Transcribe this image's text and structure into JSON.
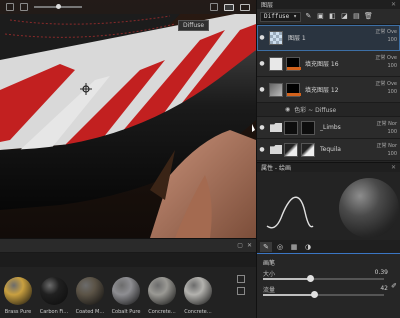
{
  "viewport": {
    "channel_label": "Diffuse",
    "toolbar_icons": [
      "grid-icon",
      "brush-icon",
      "settings-icon",
      "view-icon",
      "camera-icon"
    ]
  },
  "layers_panel": {
    "title": "图层",
    "channel_select": "Diffuse",
    "layers": [
      {
        "name": "图层 1",
        "blend": "Ove",
        "blend_prefix": "正常",
        "opacity": "100",
        "thumb": "checker",
        "selected": true
      },
      {
        "name": "填充图层 16",
        "blend": "Ove",
        "blend_prefix": "正常",
        "opacity": "100",
        "thumb": "white",
        "mask": true
      },
      {
        "name": "填充图层 12",
        "blend": "Ove",
        "blend_prefix": "正常",
        "opacity": "100",
        "thumb": "gradient",
        "mask": true
      }
    ],
    "sub_item": "色彩 ~ Diffuse",
    "folders": [
      {
        "name": "_Limbs",
        "blend": "Nor",
        "blend_prefix": "正常",
        "opacity": "100",
        "thumb": "dark"
      },
      {
        "name": "Tequila",
        "blend": "Nor",
        "blend_prefix": "正常",
        "opacity": "100",
        "thumb": "skin"
      }
    ]
  },
  "properties_panel": {
    "title": "属性 - 绘画"
  },
  "brush_panel": {
    "section": "画笔",
    "params": [
      {
        "label": "大小",
        "value": "0.39",
        "level": 0.39
      },
      {
        "label": "流量",
        "value": "42",
        "level": 0.42
      }
    ]
  },
  "shelf": {
    "materials": [
      {
        "name": "Brass Pure",
        "color": "#c9a040"
      },
      {
        "name": "Carbon Fi…",
        "color": "#202020"
      },
      {
        "name": "Coated M…",
        "color": "#5b5346"
      },
      {
        "name": "Cobalt Pure",
        "color": "#8e8e92"
      },
      {
        "name": "Concrete…",
        "color": "#9a9994"
      },
      {
        "name": "Concrete…",
        "color": "#b3b2ae"
      }
    ]
  }
}
